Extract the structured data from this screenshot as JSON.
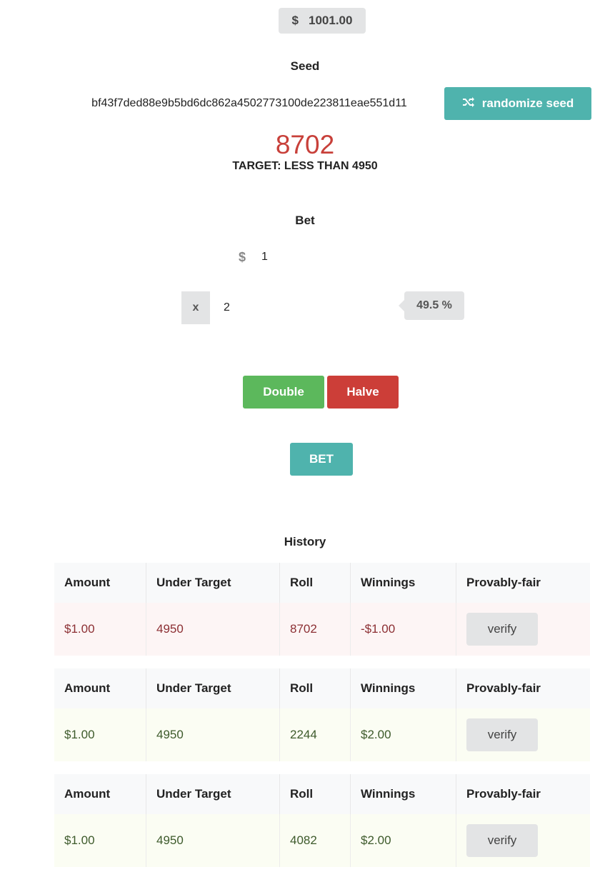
{
  "balance": {
    "currency_symbol": "$",
    "amount": "1001.00"
  },
  "seed": {
    "label": "Seed",
    "value": "bf43f7ded88e9b5bd6dc862a4502773100de223811eae551d11",
    "randomize_label": "randomize seed"
  },
  "result": {
    "roll": "8702",
    "target_text": "TARGET: LESS THAN 4950"
  },
  "bet": {
    "label": "Bet",
    "currency_symbol": "$",
    "amount": "1",
    "multiplier_prefix": "x",
    "multiplier": "2",
    "win_chance": "49.5 %",
    "double_label": "Double",
    "halve_label": "Halve",
    "bet_label": "BET"
  },
  "history": {
    "label": "History",
    "columns": [
      "Amount",
      "Under Target",
      "Roll",
      "Winnings",
      "Provably-fair"
    ],
    "verify_label": "verify",
    "rows": [
      {
        "amount": "$1.00",
        "target": "4950",
        "roll": "8702",
        "winnings": "-$1.00",
        "outcome": "loss"
      },
      {
        "amount": "$1.00",
        "target": "4950",
        "roll": "2244",
        "winnings": "$2.00",
        "outcome": "win"
      },
      {
        "amount": "$1.00",
        "target": "4950",
        "roll": "4082",
        "winnings": "$2.00",
        "outcome": "win"
      }
    ]
  },
  "colors": {
    "accent": "#4fb3ad",
    "success": "#5cb85c",
    "danger": "#cc3e38",
    "result_red": "#c8403a"
  },
  "icons": {
    "randomize": "shuffle-icon",
    "currency": "dollar-icon"
  }
}
